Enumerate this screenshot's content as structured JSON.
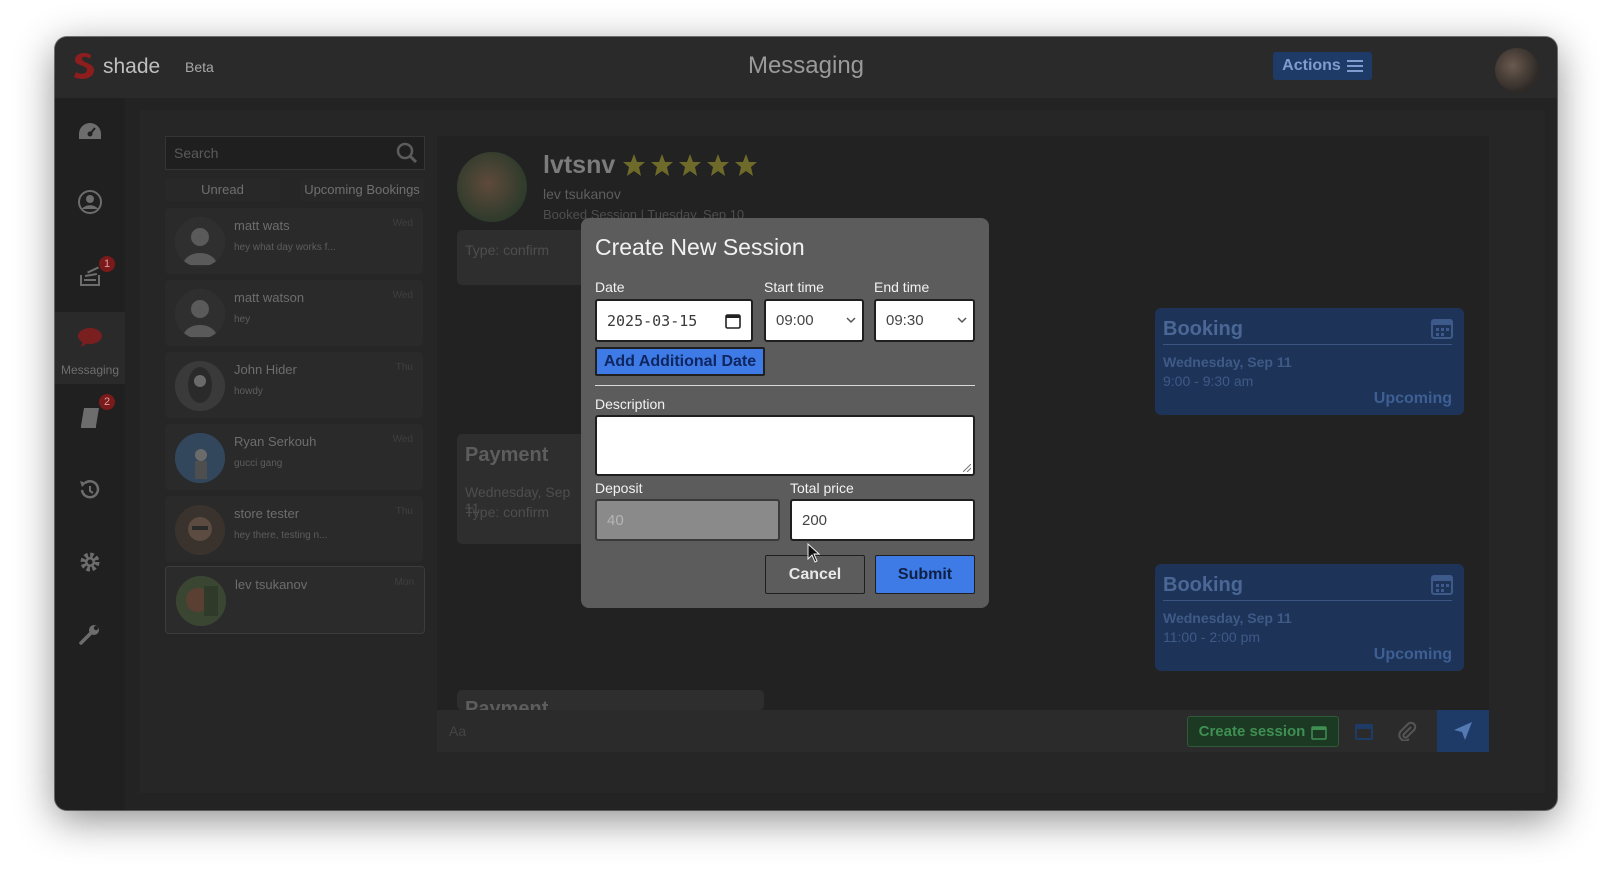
{
  "app": {
    "logo_text": "shade",
    "beta_label": "Beta",
    "page_title": "Messaging",
    "actions_label": "Actions"
  },
  "sidebar": {
    "items": [
      {
        "icon": "dashboard-icon"
      },
      {
        "icon": "profile-icon"
      },
      {
        "icon": "bookings-icon",
        "badge": "1"
      },
      {
        "icon": "messaging-icon",
        "label": "Messaging"
      },
      {
        "icon": "book-icon",
        "badge": "2"
      },
      {
        "icon": "history-icon"
      },
      {
        "icon": "settings-icon"
      },
      {
        "icon": "tools-icon"
      }
    ]
  },
  "conversations": {
    "search_placeholder": "Search",
    "tabs": [
      "Unread",
      "Upcoming Bookings"
    ],
    "items": [
      {
        "name": "matt wats",
        "preview": "hey what day works f...",
        "day": "Wed"
      },
      {
        "name": "matt watson",
        "preview": "hey",
        "day": "Wed"
      },
      {
        "name": "John Hider",
        "preview": "howdy",
        "day": "Thu"
      },
      {
        "name": "Ryan Serkouh",
        "preview": "gucci gang",
        "day": "Wed"
      },
      {
        "name": "store tester",
        "preview": "hey there, testing n...",
        "day": "Thu"
      },
      {
        "name": "lev tsukanov",
        "preview": "",
        "day": "Mon"
      }
    ]
  },
  "chat": {
    "handle": "lvtsnv",
    "full_name": "lev tsukanov",
    "booked": "Booked Session | Tuesday, Sep 10",
    "messages": [
      {
        "title": "",
        "line1": "Type: confirm"
      },
      {
        "title": "Payment",
        "line1": "Wednesday, Sep 11",
        "line2": "Type: confirm"
      },
      {
        "title": "Payment"
      }
    ],
    "bookings": [
      {
        "title": "Booking",
        "date": "Wednesday, Sep 11",
        "time": "9:00 - 9:30 am",
        "status": "Upcoming"
      },
      {
        "title": "Booking",
        "date": "Wednesday, Sep 11",
        "time": "11:00 - 2:00 pm",
        "status": "Upcoming"
      }
    ],
    "compose_placeholder": "Aa",
    "create_session_label": "Create session"
  },
  "modal": {
    "title": "Create New Session",
    "date_label": "Date",
    "date_value": "2025-03-15",
    "start_label": "Start time",
    "start_value": "09:00",
    "end_label": "End time",
    "end_value": "09:30",
    "add_date_label": "Add Additional Date",
    "description_label": "Description",
    "description_value": "",
    "deposit_label": "Deposit",
    "deposit_value": "40",
    "total_label": "Total price",
    "total_value": "200",
    "cancel_label": "Cancel",
    "submit_label": "Submit"
  },
  "colors": {
    "accent_blue": "#3e7be6",
    "modal_bg": "#5c5c5c",
    "badge_red": "#7a1a1a",
    "create_green": "#3f8f52"
  }
}
